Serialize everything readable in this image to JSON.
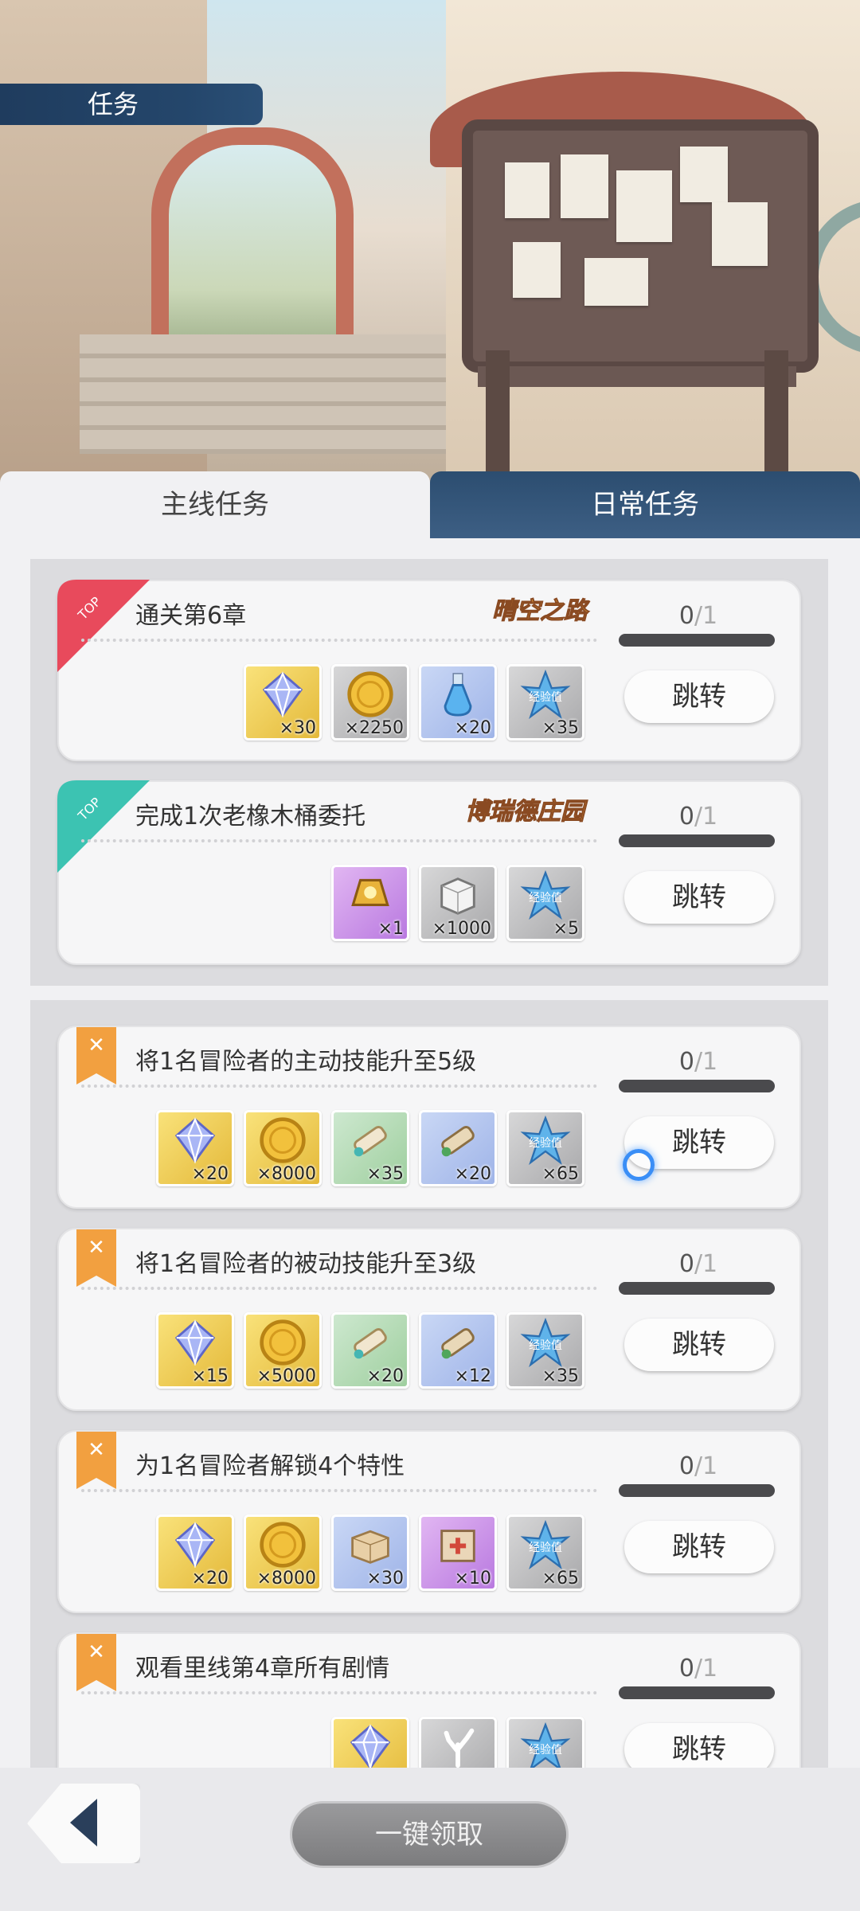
{
  "window": {
    "title": "任务"
  },
  "tabs": [
    {
      "label": "主线任务",
      "active": true
    },
    {
      "label": "日常任务",
      "active": false
    }
  ],
  "pinned_quests": [
    {
      "label": "通关第6章",
      "tag": "晴空之路",
      "progress": "0",
      "total": "/1",
      "button": "跳转",
      "badge_color": "#e84a5c",
      "badge_text": "TOP",
      "rewards": [
        {
          "icon": "gem-icon",
          "bg": "gold",
          "count": "×30"
        },
        {
          "icon": "gold-coin-icon",
          "bg": "grey",
          "count": "×2250"
        },
        {
          "icon": "potion-icon",
          "bg": "blue",
          "count": "×20"
        },
        {
          "icon": "exp-crystal-icon",
          "bg": "grey",
          "count": "×35"
        }
      ]
    },
    {
      "label": "完成1次老橡木桶委托",
      "tag": "博瑞德庄园",
      "progress": "0",
      "total": "/1",
      "button": "跳转",
      "badge_color": "#3cc3b2",
      "badge_text": "TOP",
      "rewards": [
        {
          "icon": "golden-relic-icon",
          "bg": "purple",
          "count": "×1"
        },
        {
          "icon": "material-block-icon",
          "bg": "grey",
          "count": "×1000"
        },
        {
          "icon": "exp-crystal-icon",
          "bg": "grey",
          "count": "×5"
        }
      ]
    }
  ],
  "quests": [
    {
      "label": "将1名冒险者的主动技能升至5级",
      "progress": "0",
      "total": "/1",
      "button": "跳转",
      "rewards": [
        {
          "icon": "gem-icon",
          "bg": "gold",
          "count": "×20"
        },
        {
          "icon": "gold-coin-icon",
          "bg": "gold",
          "count": "×8000"
        },
        {
          "icon": "skill-scroll-icon",
          "bg": "green",
          "count": "×35"
        },
        {
          "icon": "skill-scroll-icon",
          "bg": "blue",
          "count": "×20"
        },
        {
          "icon": "exp-crystal-icon",
          "bg": "grey",
          "count": "×65"
        }
      ]
    },
    {
      "label": "将1名冒险者的被动技能升至3级",
      "progress": "0",
      "total": "/1",
      "button": "跳转",
      "rewards": [
        {
          "icon": "gem-icon",
          "bg": "gold",
          "count": "×15"
        },
        {
          "icon": "gold-coin-icon",
          "bg": "gold",
          "count": "×5000"
        },
        {
          "icon": "skill-scroll-icon",
          "bg": "green",
          "count": "×20"
        },
        {
          "icon": "skill-scroll-icon",
          "bg": "blue",
          "count": "×12"
        },
        {
          "icon": "exp-crystal-icon",
          "bg": "grey",
          "count": "×35"
        }
      ]
    },
    {
      "label": "为1名冒险者解锁4个特性",
      "progress": "0",
      "total": "/1",
      "button": "跳转",
      "rewards": [
        {
          "icon": "gem-icon",
          "bg": "gold",
          "count": "×20"
        },
        {
          "icon": "gold-coin-icon",
          "bg": "gold",
          "count": "×8000"
        },
        {
          "icon": "package-icon",
          "bg": "blue",
          "count": "×30"
        },
        {
          "icon": "supply-box-icon",
          "bg": "purple",
          "count": "×10"
        },
        {
          "icon": "exp-crystal-icon",
          "bg": "grey",
          "count": "×65"
        }
      ]
    },
    {
      "label": "观看里线第4章所有剧情",
      "progress": "0",
      "total": "/1",
      "button": "跳转",
      "rewards": [
        {
          "icon": "gem-icon",
          "bg": "gold",
          "count": ""
        },
        {
          "icon": "coral-icon",
          "bg": "grey",
          "count": ""
        },
        {
          "icon": "exp-crystal-icon",
          "bg": "grey",
          "count": ""
        }
      ]
    }
  ],
  "exp_label": "经验值",
  "bottom": {
    "claim_all": "一键领取"
  },
  "colors": {
    "accent_navy": "#24466b",
    "tag_orange": "#e9a33a",
    "progress_bar": "#4a4a4d"
  }
}
